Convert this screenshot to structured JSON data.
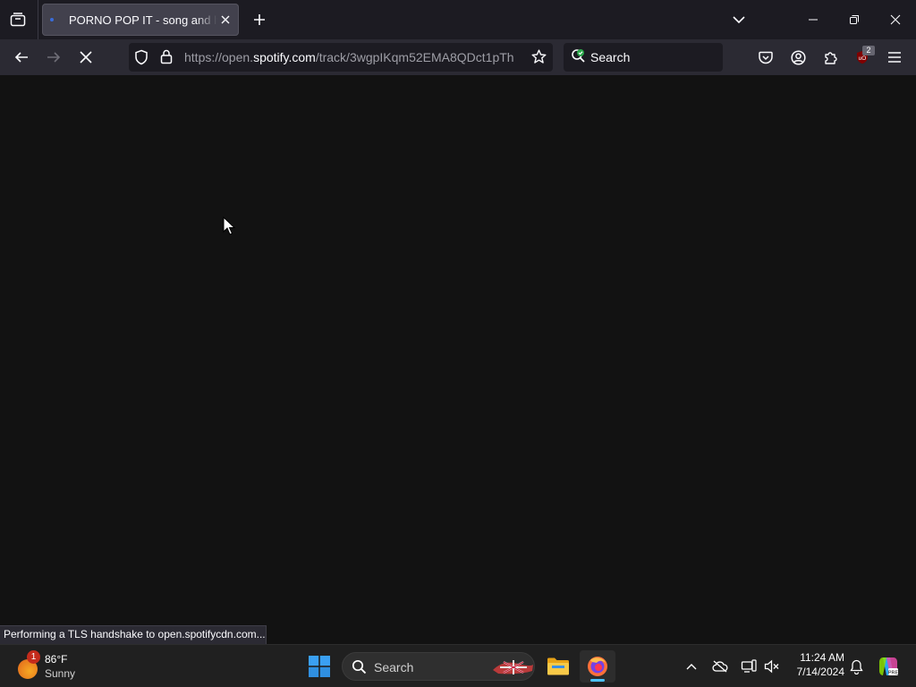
{
  "browser": {
    "tab": {
      "title": "PORNO POP IT - song and lyrics by"
    },
    "url": {
      "prefix": "https://open.",
      "domain": "spotify.com",
      "path": "/track/3wgpIKqm52EMA8QDct1pTh"
    },
    "search": {
      "label": "Search"
    },
    "extensions_badge": "2",
    "status_text": "Performing a TLS handshake to open.spotifycdn.com..."
  },
  "taskbar": {
    "weather": {
      "temp": "86°F",
      "condition": "Sunny",
      "badge": "1"
    },
    "search": {
      "label": "Search"
    },
    "clock": {
      "time": "11:24 AM",
      "date": "7/14/2024"
    }
  },
  "colors": {
    "content_bg": "#121212",
    "toolbar_bg": "#2b2a33",
    "tabstrip_bg": "#1c1b22",
    "taskbar_bg": "#202020",
    "accent_indicator": "#4cc2ff"
  },
  "icons": {
    "tab_list": "tab-list-icon",
    "favicon": "spotify-favicon",
    "tab_close": "close-icon",
    "new_tab": "plus-icon",
    "list_tabs": "chevron-down-icon",
    "back": "back-arrow-icon",
    "forward": "forward-arrow-icon",
    "stop": "stop-icon",
    "tracking_protection": "shield-icon",
    "site_security": "lock-icon",
    "bookmark": "star-icon",
    "pocket": "pocket-icon",
    "account": "account-icon",
    "extensions": "puzzle-icon",
    "ublock": "ublock-icon",
    "menu": "hamburger-icon"
  }
}
